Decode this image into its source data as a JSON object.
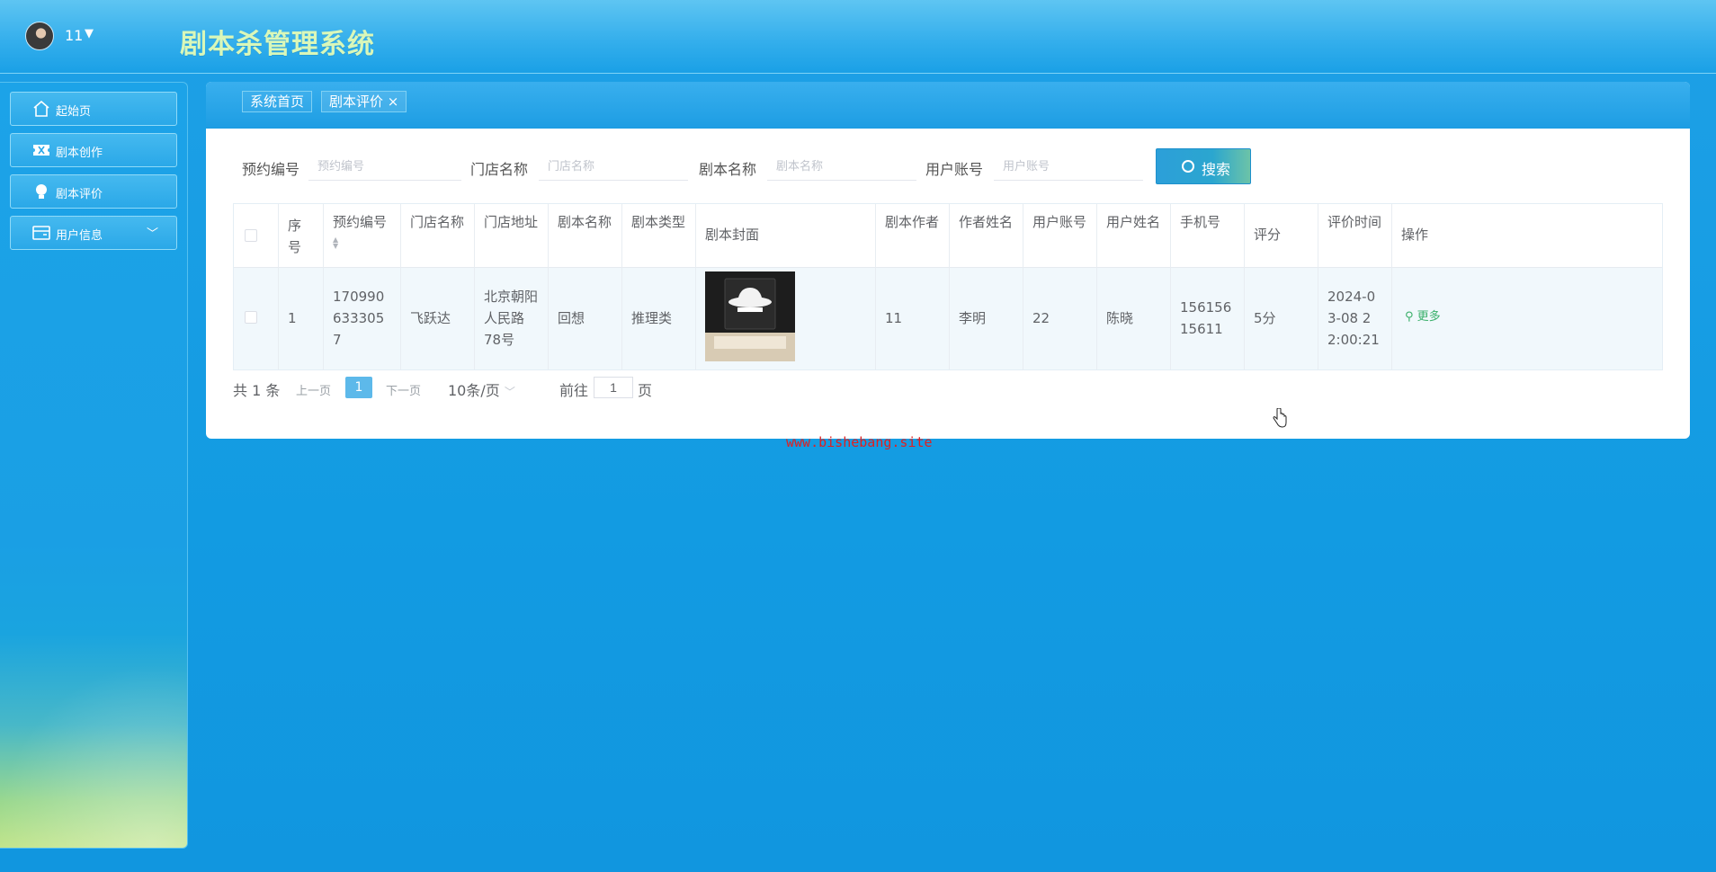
{
  "header": {
    "username": "11",
    "app_title": "剧本杀管理系统"
  },
  "sidebar": {
    "items": [
      {
        "label": "起始页",
        "icon": "home-icon"
      },
      {
        "label": "剧本创作",
        "icon": "ticket-icon"
      },
      {
        "label": "剧本评价",
        "icon": "bulb-icon"
      },
      {
        "label": "用户信息",
        "icon": "card-icon"
      }
    ]
  },
  "tabs": [
    {
      "label": "系统首页"
    },
    {
      "label": "剧本评价",
      "close": "×"
    }
  ],
  "search": {
    "fields": [
      {
        "label": "预约编号",
        "placeholder": "预约编号"
      },
      {
        "label": "门店名称",
        "placeholder": "门店名称"
      },
      {
        "label": "剧本名称",
        "placeholder": "剧本名称"
      },
      {
        "label": "用户账号",
        "placeholder": "用户账号"
      }
    ],
    "button_label": "搜索"
  },
  "table": {
    "columns": [
      "序号",
      "预约编号",
      "门店名称",
      "门店地址",
      "剧本名称",
      "剧本类型",
      "剧本封面",
      "剧本作者",
      "作者姓名",
      "用户账号",
      "用户姓名",
      "手机号",
      "评分",
      "评价时间",
      "操作"
    ],
    "rows": [
      {
        "index": "1",
        "booking_no": "1709906333057",
        "store_name": "飞跃达",
        "store_address": "北京朝阳人民路78号",
        "script_name": "回想",
        "script_type": "推理类",
        "cover_alt": "剧本封面",
        "author": "11",
        "author_name": "李明",
        "user_account": "22",
        "user_name": "陈晓",
        "phone": "15615615611",
        "rating": "5分",
        "review_time": "2024-03-08 22:00:21",
        "action": "更多"
      }
    ]
  },
  "pagination": {
    "total": "共 1 条",
    "prev": "上一页",
    "current": "1",
    "next": "下一页",
    "page_size": "10条/页",
    "goto_label": "前往",
    "goto_value": "1",
    "page_suffix": "页"
  },
  "watermark": "www.bishebang.site",
  "colors": {
    "accent": "#1aa0e6",
    "title": "#d9f7b9",
    "link": "#3bb06b"
  }
}
